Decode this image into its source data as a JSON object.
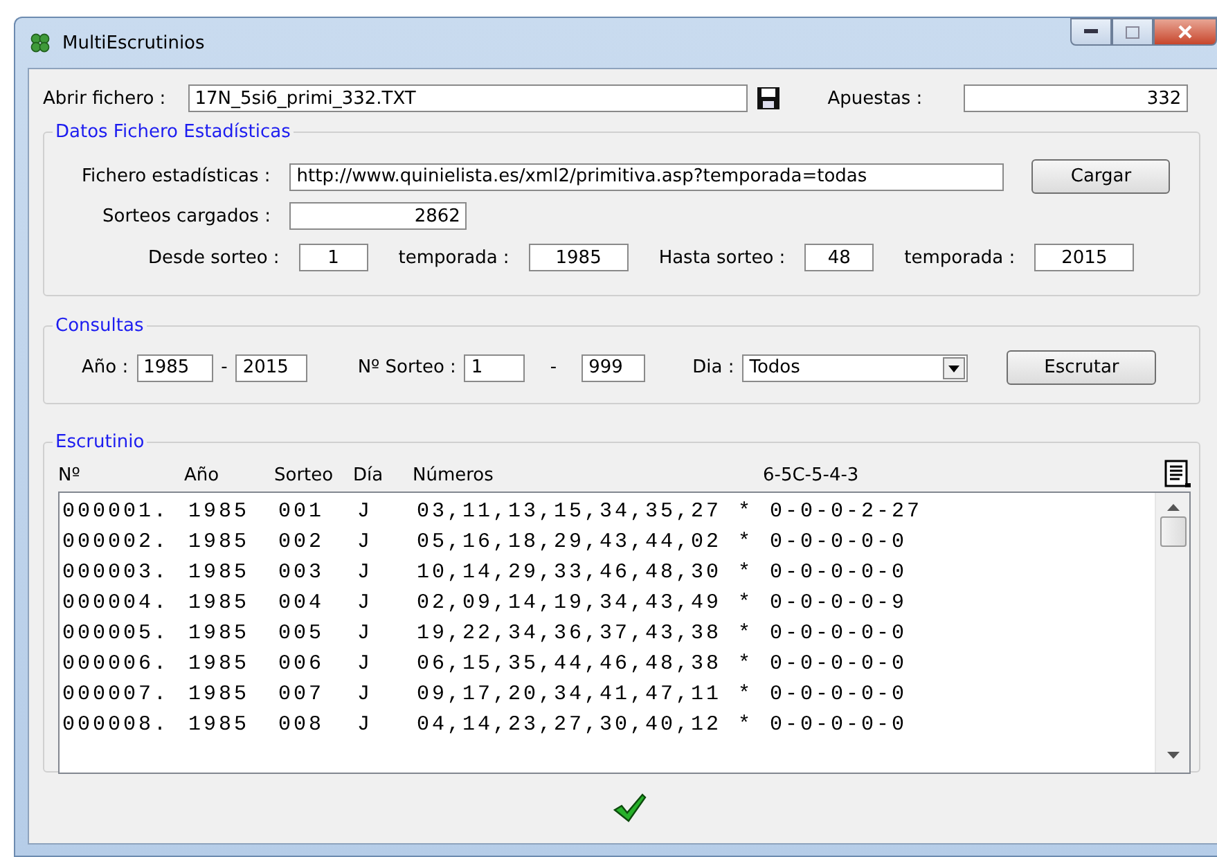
{
  "window": {
    "title": "MultiEscrutinios"
  },
  "file": {
    "label": "Abrir fichero :",
    "value": "17N_5si6_primi_332.TXT"
  },
  "bets": {
    "label": "Apuestas :",
    "value": "332"
  },
  "stats": {
    "legend": "Datos Fichero Estadísticas",
    "file_label": "Fichero estadísticas :",
    "file_value": "http://www.quinielista.es/xml2/primitiva.asp?temporada=todas",
    "load_button": "Cargar",
    "loaded_label": "Sorteos cargados :",
    "loaded_value": "2862",
    "from_label": "Desde sorteo :",
    "from_value": "1",
    "season_from_label": "temporada :",
    "season_from_value": "1985",
    "to_label": "Hasta sorteo :",
    "to_value": "48",
    "season_to_label": "temporada :",
    "season_to_value": "2015"
  },
  "queries": {
    "legend": "Consultas",
    "year_label": "Año :",
    "year_from": "1985",
    "year_sep": "-",
    "year_to": "2015",
    "draw_label": "Nº Sorteo :",
    "draw_from": "1",
    "draw_sep": "-",
    "draw_to": "999",
    "day_label": "Dia :",
    "day_value": "Todos",
    "button": "Escrutar"
  },
  "results": {
    "legend": "Escrutinio",
    "columns": [
      "Nº",
      "Año",
      "Sorteo",
      "Día",
      "Números",
      "6-5C-5-4-3"
    ],
    "rows": [
      {
        "num": "000001.",
        "year": "1985",
        "draw": "001",
        "day": "J",
        "numbers": "03,11,13,15,34,35,27",
        "mark": "*",
        "result": "0-0-0-2-27"
      },
      {
        "num": "000002.",
        "year": "1985",
        "draw": "002",
        "day": "J",
        "numbers": "05,16,18,29,43,44,02",
        "mark": "*",
        "result": "0-0-0-0-0"
      },
      {
        "num": "000003.",
        "year": "1985",
        "draw": "003",
        "day": "J",
        "numbers": "10,14,29,33,46,48,30",
        "mark": "*",
        "result": "0-0-0-0-0"
      },
      {
        "num": "000004.",
        "year": "1985",
        "draw": "004",
        "day": "J",
        "numbers": "02,09,14,19,34,43,49",
        "mark": "*",
        "result": "0-0-0-0-9"
      },
      {
        "num": "000005.",
        "year": "1985",
        "draw": "005",
        "day": "J",
        "numbers": "19,22,34,36,37,43,38",
        "mark": "*",
        "result": "0-0-0-0-0"
      },
      {
        "num": "000006.",
        "year": "1985",
        "draw": "006",
        "day": "J",
        "numbers": "06,15,35,44,46,48,38",
        "mark": "*",
        "result": "0-0-0-0-0"
      },
      {
        "num": "000007.",
        "year": "1985",
        "draw": "007",
        "day": "J",
        "numbers": "09,17,20,34,41,47,11",
        "mark": "*",
        "result": "0-0-0-0-0"
      },
      {
        "num": "000008.",
        "year": "1985",
        "draw": "008",
        "day": "J",
        "numbers": "04,14,23,27,30,40,12",
        "mark": "*",
        "result": "0-0-0-0-0"
      }
    ]
  }
}
